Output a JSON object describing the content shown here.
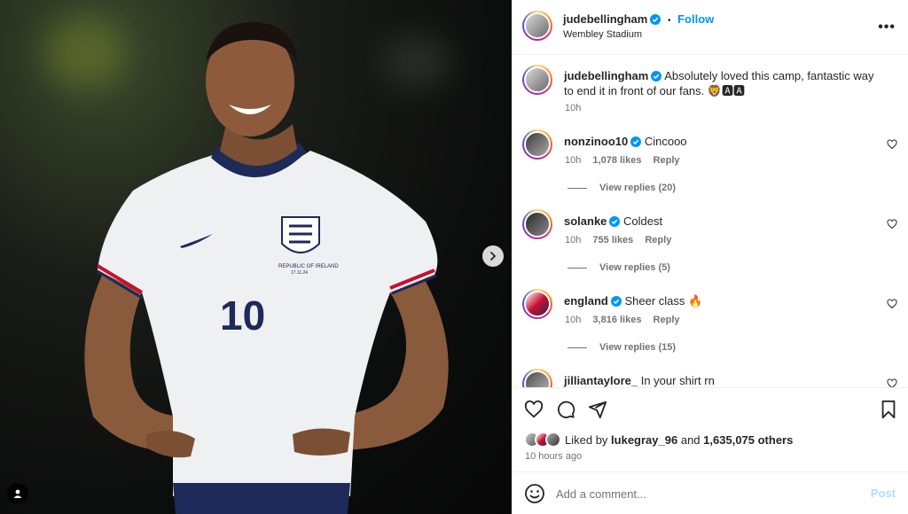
{
  "post": {
    "author": "judebellingham",
    "follow_label": "Follow",
    "dot": "•",
    "location": "Wembley Stadium",
    "more_label": "•••",
    "caption": "Absolutely loved this camp, fantastic way to end it in front of our fans. 🦁🅰🅰",
    "caption_time": "10h",
    "kit_text": "REPUBLIC OF IRELAND",
    "kit_date": "17.11.24",
    "shirt_number": "10"
  },
  "comments": [
    {
      "user": "nonzinoo10",
      "text": "Cincooo",
      "time": "10h",
      "likes": "1,078 likes",
      "reply": "Reply",
      "view_replies": "View replies (20)"
    },
    {
      "user": "solanke",
      "text": "Coldest",
      "time": "10h",
      "likes": "755 likes",
      "reply": "Reply",
      "view_replies": "View replies (5)"
    },
    {
      "user": "england",
      "text": "Sheer class 🔥",
      "time": "10h",
      "likes": "3,816 likes",
      "reply": "Reply",
      "view_replies": "View replies (15)"
    },
    {
      "user": "jilliantaylore_",
      "text": "In your shirt rn"
    }
  ],
  "engagement": {
    "liked_prefix": "Liked by",
    "liked_user": "lukegray_96",
    "liked_and": "and",
    "liked_others": "1,635,075 others",
    "time_ago": "10 hours ago"
  },
  "composer": {
    "placeholder": "Add a comment...",
    "post_label": "Post"
  },
  "icons": [
    "verified-icon",
    "more-icon",
    "heart-icon",
    "comment-icon",
    "share-icon",
    "save-icon",
    "emoji-icon",
    "next-arrow-icon",
    "tagged-user-icon"
  ],
  "colors": {
    "accent": "#0095f6",
    "verified": "#0095f6",
    "muted": "#737373",
    "post_disabled": "#b3dbff"
  }
}
